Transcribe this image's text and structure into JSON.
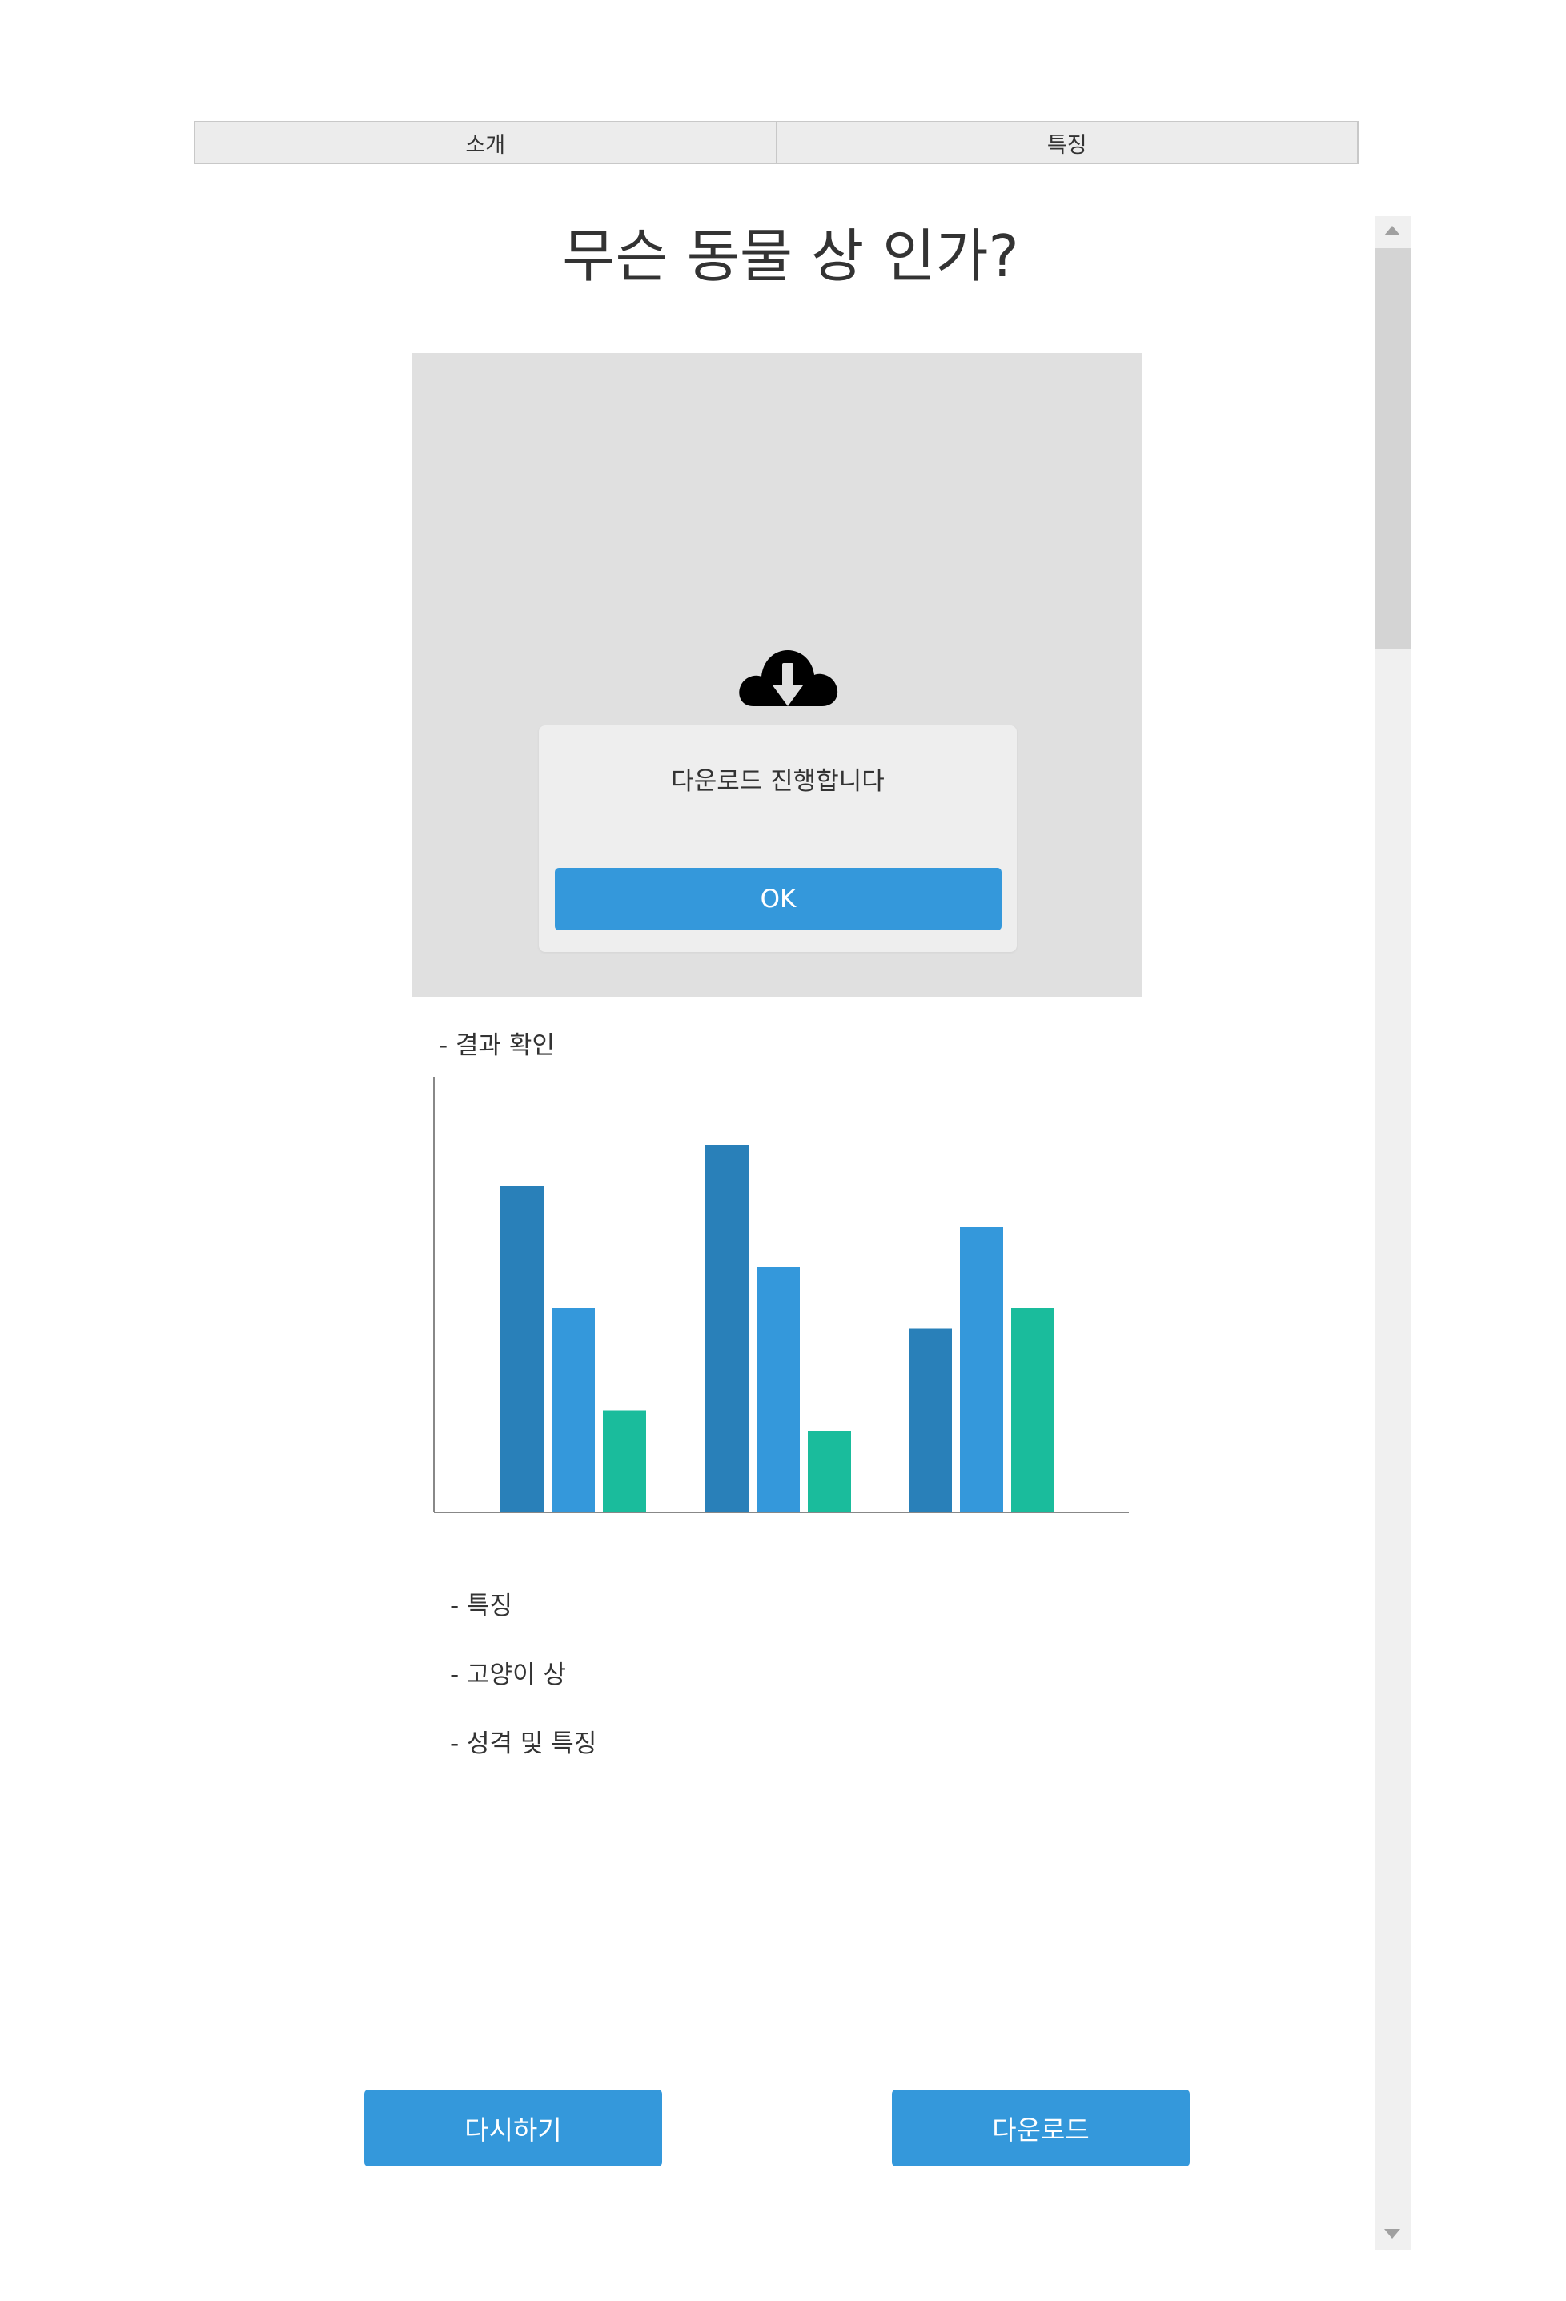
{
  "tabs": [
    {
      "label": "소개"
    },
    {
      "label": "특징"
    }
  ],
  "title": "무슨 동물 상 인가?",
  "dialog": {
    "message": "다운로드 진행합니다",
    "ok_label": "OK"
  },
  "result_label": "- 결과 확인",
  "colors": {
    "accent": "#3498db",
    "series_dark_blue": "#2980b9",
    "series_blue": "#3498db",
    "series_teal": "#1abc9c"
  },
  "chart_data": {
    "type": "bar",
    "categories": [
      "",
      "",
      ""
    ],
    "series": [
      {
        "color": "#2980b9",
        "values": [
          80,
          90,
          45
        ]
      },
      {
        "color": "#3498db",
        "values": [
          50,
          60,
          70
        ]
      },
      {
        "color": "#1abc9c",
        "values": [
          25,
          20,
          50
        ]
      }
    ],
    "ylim": [
      0,
      100
    ],
    "grid": false,
    "legend": "none"
  },
  "side_list": [
    "- 특징",
    "- 고양이 상",
    "- 성격 및 특징"
  ],
  "buttons": {
    "retry": "다시하기",
    "download": "다운로드"
  },
  "icons": {
    "dialog_icon": "cloud-download-icon"
  }
}
